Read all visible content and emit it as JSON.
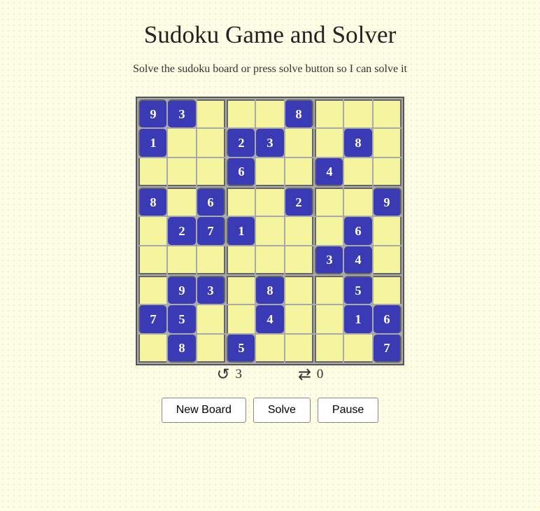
{
  "title": "Sudoku Game and Solver",
  "subtitle": "Solve the sudoku board or press solve button so I can solve it",
  "grid": [
    [
      9,
      3,
      0,
      0,
      0,
      8,
      0,
      0,
      0
    ],
    [
      1,
      0,
      0,
      2,
      3,
      0,
      0,
      8,
      0
    ],
    [
      0,
      0,
      0,
      6,
      0,
      0,
      4,
      0,
      0
    ],
    [
      8,
      0,
      6,
      0,
      0,
      2,
      0,
      0,
      9
    ],
    [
      0,
      2,
      7,
      1,
      0,
      0,
      0,
      6,
      0
    ],
    [
      0,
      0,
      0,
      0,
      0,
      0,
      3,
      4,
      0
    ],
    [
      0,
      9,
      3,
      0,
      8,
      0,
      0,
      5,
      0
    ],
    [
      7,
      5,
      0,
      0,
      4,
      0,
      0,
      1,
      6
    ],
    [
      0,
      8,
      0,
      5,
      0,
      0,
      0,
      0,
      7
    ]
  ],
  "stats": {
    "mistakes_icon": "↺",
    "mistakes_label": "3",
    "hints_icon": "⇌",
    "hints_label": "0"
  },
  "buttons": {
    "new_board": "New Board",
    "solve": "Solve",
    "pause": "Pause"
  }
}
